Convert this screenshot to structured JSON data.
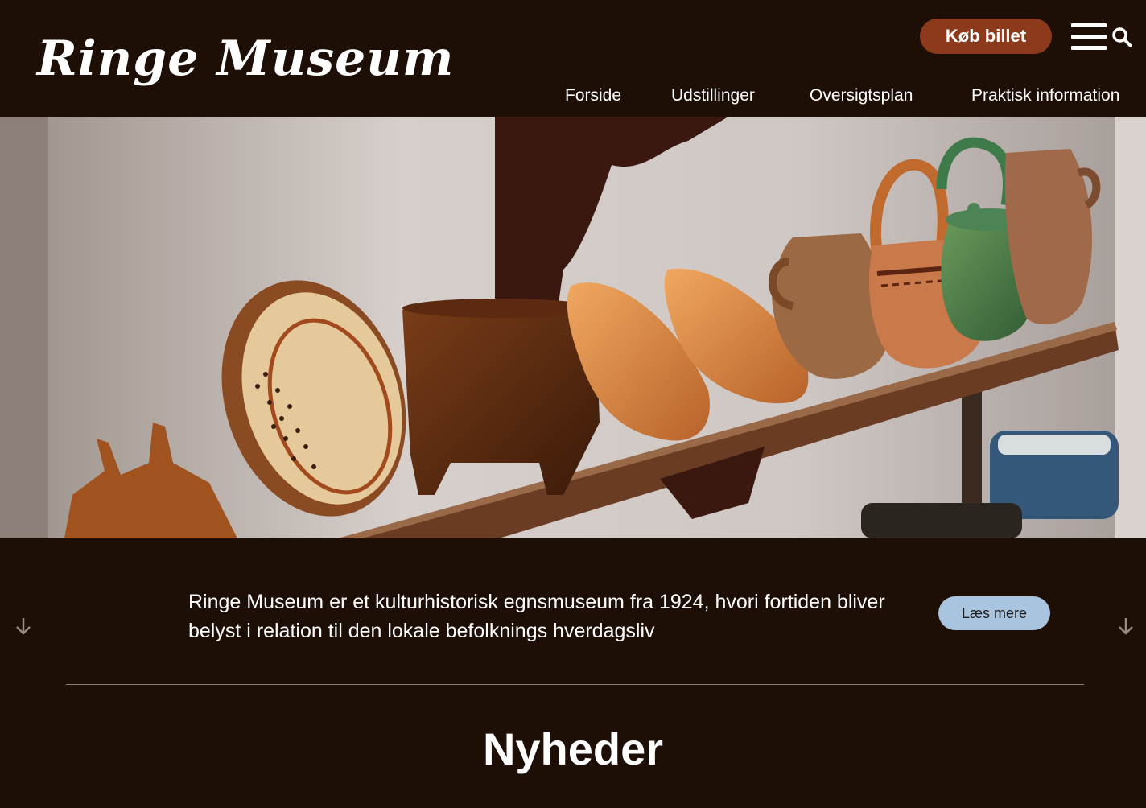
{
  "header": {
    "logo": "Ringe Museum",
    "ticket_label": "Køb billet",
    "menu_icon": "hamburger-menu-icon",
    "search_icon": "search-icon",
    "nav": [
      {
        "label": "Forside"
      },
      {
        "label": "Udstillinger"
      },
      {
        "label": "Oversigtsplan"
      },
      {
        "label": "Praktisk information"
      }
    ]
  },
  "hero": {
    "image": "photo of ceramic pottery on a wooden shelf"
  },
  "intro": {
    "text": "Ringe Museum er et kulturhistorisk egnsmuseum fra 1924, hvori fortiden bliver belyst i relation til den lokale befolknings hverdagsliv",
    "button_label": "Læs mere",
    "left_arrow_icon": "arrow-down-icon",
    "right_arrow_icon": "arrow-down-icon"
  },
  "news": {
    "title": "Nyheder"
  },
  "colors": {
    "background": "#1e0f06",
    "ticket_button": "#8c3a1b",
    "more_button": "#a9c4df"
  }
}
